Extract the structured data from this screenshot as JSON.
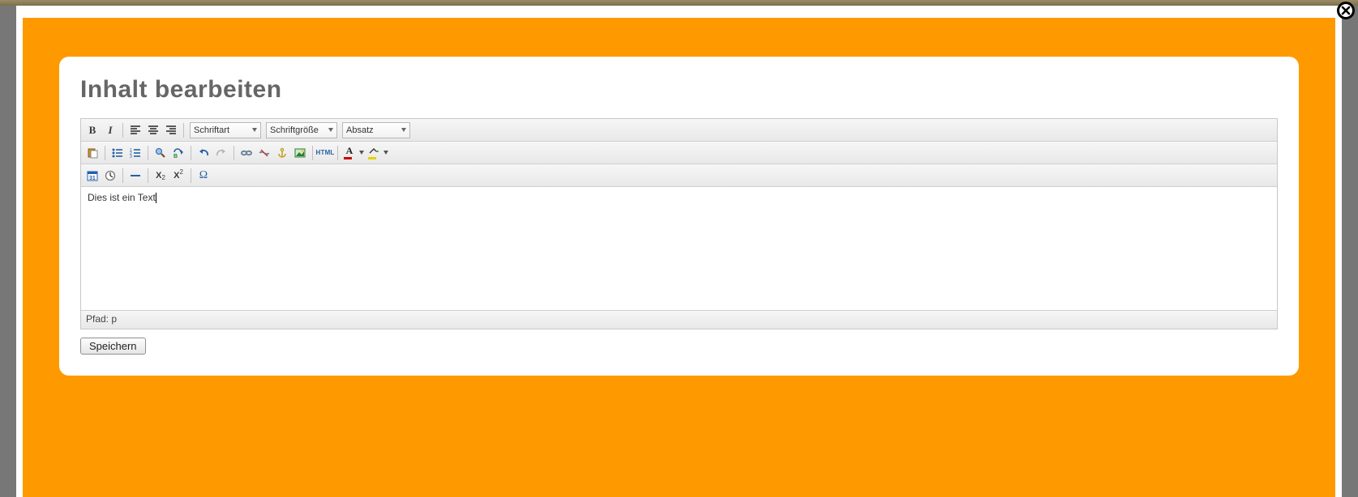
{
  "title": "Inhalt bearbeiten",
  "toolbar": {
    "font_family_label": "Schriftart",
    "font_size_label": "Schriftgröße",
    "block_format_label": "Absatz"
  },
  "editor": {
    "content": "Dies ist ein Text"
  },
  "statusbar": {
    "path_label": "Pfad: p"
  },
  "buttons": {
    "save": "Speichern"
  }
}
